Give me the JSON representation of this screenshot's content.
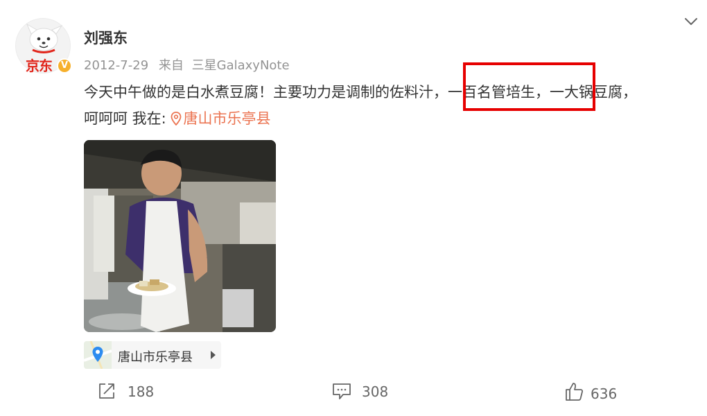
{
  "post": {
    "username": "刘强东",
    "avatar_brand": "京东",
    "verified_mark": "V",
    "date": "2012-7-29",
    "source_prefix": "来自",
    "source_device": "三星GalaxyNote",
    "text_line1": "今天中午做的是白水煮豆腐！主要功力是调制的佐料汁，一百名管培生，一大锅豆腐，",
    "text_line2_prefix": "呵呵呵 我在:",
    "location_link": "唐山市乐亭县",
    "location_card": "唐山市乐亭县"
  },
  "actions": {
    "repost_count": "188",
    "comment_count": "308",
    "like_count": "636"
  },
  "colors": {
    "link": "#eb7350",
    "highlight_box": "#e60000",
    "verified_badge": "#f6b02c",
    "muted_text": "#939393"
  }
}
